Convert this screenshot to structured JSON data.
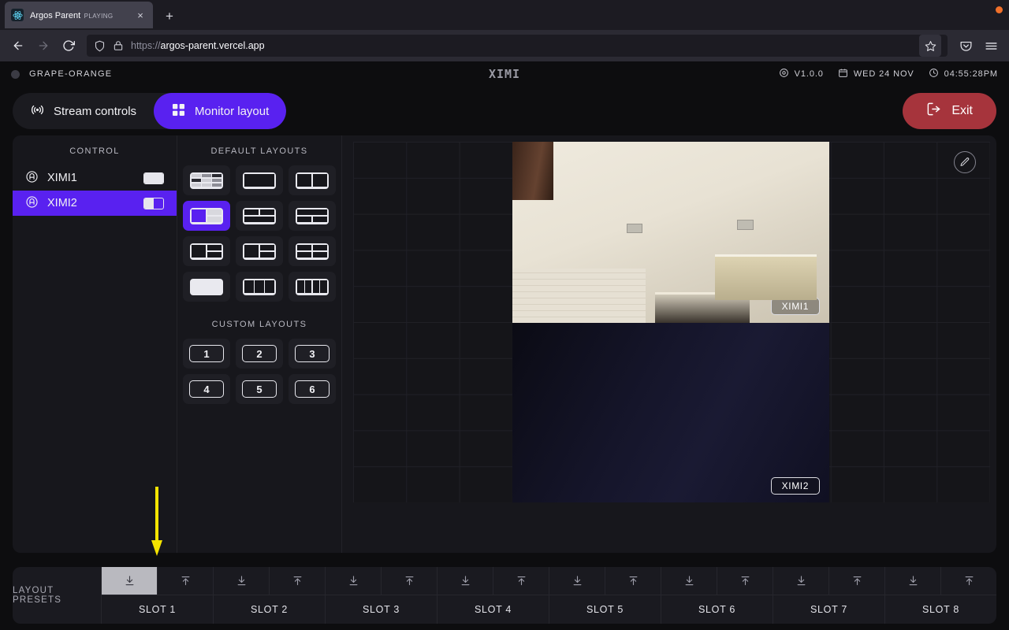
{
  "browser": {
    "tab": {
      "title": "Argos Parent",
      "subtitle": "PLAYING",
      "favicon": "react-icon",
      "close": "×"
    },
    "new_tab": "+",
    "nav": {
      "back": "←",
      "forward": "→",
      "reload": "↻"
    },
    "url": {
      "scheme": "https://",
      "host": "argos-parent.vercel.app"
    },
    "icons": {
      "shield": "shield-icon",
      "lock": "lock-icon",
      "bookmark": "star-icon",
      "pocket": "pocket-icon",
      "menu": "hamburger-menu-icon"
    }
  },
  "topbar": {
    "site_name": "GRAPE-ORANGE",
    "brand": "XIMI",
    "version": "V1.0.0",
    "date": "WED 24 NOV",
    "time": "04:55:28PM"
  },
  "tabs": [
    {
      "label": "Stream controls",
      "icon": "broadcast-icon",
      "active": false
    },
    {
      "label": "Monitor layout",
      "icon": "grid-icon",
      "active": true
    }
  ],
  "exit": {
    "label": "Exit",
    "icon": "logout-icon",
    "color": "#a6343c"
  },
  "control": {
    "title": "CONTROL",
    "devices": [
      {
        "name": "XIMI1",
        "selected": false,
        "layout_indicator": "full"
      },
      {
        "name": "XIMI2",
        "selected": true,
        "layout_indicator": "left-half"
      }
    ]
  },
  "layouts": {
    "default_title": "DEFAULT LAYOUTS",
    "default_items": [
      {
        "id": "grid-mixed",
        "active": false
      },
      {
        "id": "single",
        "active": false
      },
      {
        "id": "two-columns",
        "active": false
      },
      {
        "id": "left-main-right-stack",
        "active": true
      },
      {
        "id": "two-top-one-bottom",
        "active": false
      },
      {
        "id": "one-top-two-bottom",
        "active": false
      },
      {
        "id": "left-stack-right-main",
        "active": false
      },
      {
        "id": "left-main-two-right",
        "active": false
      },
      {
        "id": "quad",
        "active": false
      },
      {
        "id": "three-columns-thin",
        "active": false
      },
      {
        "id": "three-columns",
        "active": false
      },
      {
        "id": "four-columns",
        "active": false
      }
    ],
    "custom_title": "CUSTOM LAYOUTS",
    "custom_items": [
      "1",
      "2",
      "3",
      "4",
      "5",
      "6"
    ]
  },
  "preview": {
    "edit_icon": "pencil-icon",
    "panes": [
      {
        "label": "XIMI1",
        "source": "camera-1"
      },
      {
        "label": "XIMI2",
        "source": "camera-2"
      }
    ]
  },
  "presets": {
    "label": "LAYOUT PRESETS",
    "load_icon": "download-icon",
    "save_icon": "upload-icon",
    "slots": [
      {
        "name": "SLOT 1",
        "load_hover": true
      },
      {
        "name": "SLOT 2",
        "load_hover": false
      },
      {
        "name": "SLOT 3",
        "load_hover": false
      },
      {
        "name": "SLOT 4",
        "load_hover": false
      },
      {
        "name": "SLOT 5",
        "load_hover": false
      },
      {
        "name": "SLOT 6",
        "load_hover": false
      },
      {
        "name": "SLOT 7",
        "load_hover": false
      },
      {
        "name": "SLOT 8",
        "load_hover": false
      }
    ]
  },
  "annotation": {
    "arrow": "down-arrow",
    "color": "#f5e400"
  },
  "colors": {
    "accent": "#5921f0",
    "danger": "#a6343c",
    "bg": "#0d0d0f",
    "panel": "#17171c"
  }
}
